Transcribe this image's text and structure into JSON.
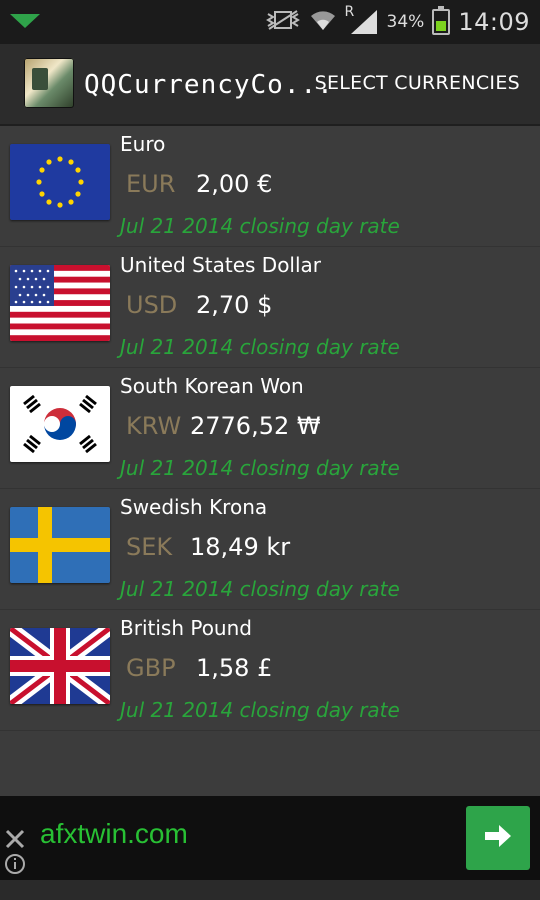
{
  "status": {
    "battery": "34%",
    "time": "14:09",
    "network_tag": "R",
    "icons": [
      "notification-icon",
      "mute-vibrate-icon",
      "wifi-icon",
      "signal-icon",
      "battery-icon"
    ]
  },
  "actionbar": {
    "title": "QQCurrencyCo...",
    "select_label": "SELECT CURRENCIES"
  },
  "currencies": [
    {
      "name": "Euro",
      "code": "EUR",
      "amount": "2,00 €",
      "date": "Jul 21 2014 closing day rate",
      "flag": "eu-flag"
    },
    {
      "name": "United States Dollar",
      "code": "USD",
      "amount": "2,70 $",
      "date": "Jul 21 2014 closing day rate",
      "flag": "us-flag"
    },
    {
      "name": "South Korean Won",
      "code": "KRW",
      "amount": "2776,52 ₩",
      "date": "Jul 21 2014 closing day rate",
      "flag": "kr-flag"
    },
    {
      "name": "Swedish Krona",
      "code": "SEK",
      "amount": "18,49 kr",
      "date": "Jul 21 2014 closing day rate",
      "flag": "se-flag"
    },
    {
      "name": "British Pound",
      "code": "GBP",
      "amount": "1,58 £",
      "date": "Jul 21 2014 closing day rate",
      "flag": "gb-flag"
    }
  ],
  "ad": {
    "text": "afxtwin.com"
  },
  "colors": {
    "background": "#3c3c3c",
    "statusbar": "#1b1b1b",
    "actionbar": "#2c2c2c",
    "rate_date": "#29a53b",
    "code": "#8a7a5a",
    "ad_green": "#28c034"
  }
}
